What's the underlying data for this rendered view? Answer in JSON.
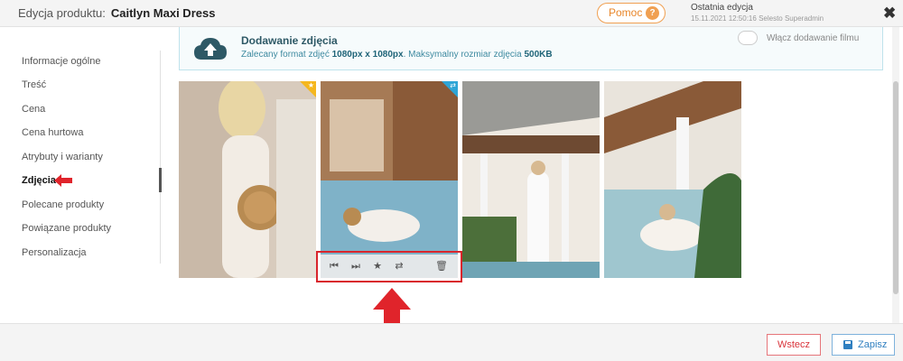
{
  "header": {
    "label": "Edycja produktu:",
    "product_name": "Caitlyn Maxi Dress",
    "help_label": "Pomoc",
    "help_icon_glyph": "?",
    "last_edit_label": "Ostatnia edycja",
    "last_edit_date": "15.11.2021",
    "last_edit_time": "12:50:16",
    "last_edit_user": "Selesto Superadmin",
    "close_glyph": "✖"
  },
  "sidebar": {
    "items": [
      {
        "label": "Informacje ogólne"
      },
      {
        "label": "Treść"
      },
      {
        "label": "Cena"
      },
      {
        "label": "Cena hurtowa"
      },
      {
        "label": "Atrybuty i warianty"
      },
      {
        "label": "Zdjęcia"
      },
      {
        "label": "Polecane produkty"
      },
      {
        "label": "Powiązane produkty"
      },
      {
        "label": "Personalizacja"
      }
    ],
    "active_index": 5
  },
  "upload": {
    "title": "Dodawanie zdjęcia",
    "sub_prefix": "Zalecany format zdjęć",
    "sub_format": "1080px x 1080px",
    "sub_mid": ". Maksymalny rozmiar zdjęcia",
    "sub_size": "500KB",
    "toggle_label": "Włącz dodawanie filmu"
  },
  "photos": {
    "badges": {
      "main": "★",
      "swap": "⇄"
    },
    "toolbar": {
      "first": "⏮",
      "next": "⏭",
      "star": "★",
      "swap": "⇄",
      "delete": "🗑"
    }
  },
  "footer": {
    "back_label": "Wstecz",
    "save_label": "Zapisz"
  },
  "colors": {
    "accent_red": "#d9252c",
    "help_orange": "#f0a052",
    "primary_blue": "#2f7fc0"
  }
}
